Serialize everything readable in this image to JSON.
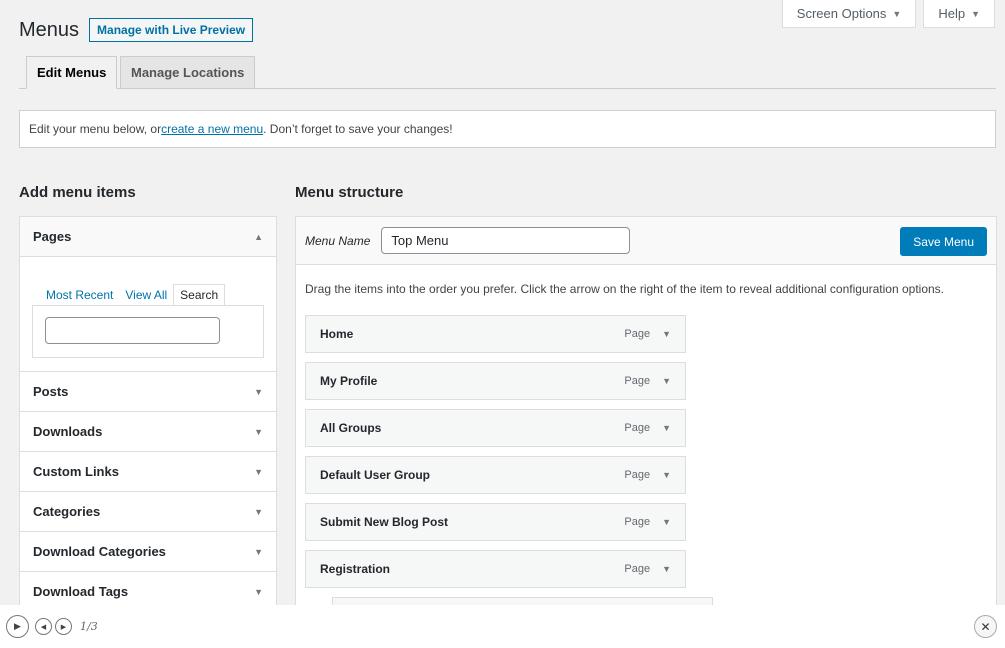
{
  "screen_tabs": [
    {
      "label": "Screen Options",
      "caret": "▼"
    },
    {
      "label": "Help",
      "caret": "▼"
    }
  ],
  "header": {
    "title": "Menus",
    "preview_button": "Manage with Live Preview"
  },
  "tabs": [
    {
      "label": "Edit Menus"
    },
    {
      "label": "Manage Locations"
    }
  ],
  "notice": {
    "before": "Edit your menu below, or ",
    "link": "create a new menu",
    "after": ". Don’t forget to save your changes!"
  },
  "add_items": {
    "heading": "Add menu items",
    "pages": {
      "label": "Pages",
      "caret": "▲",
      "subtabs": [
        "Most Recent",
        "View All",
        "Search"
      ],
      "search_value": ""
    },
    "sections": [
      {
        "label": "Posts",
        "caret": "▼"
      },
      {
        "label": "Downloads",
        "caret": "▼"
      },
      {
        "label": "Custom Links",
        "caret": "▼"
      },
      {
        "label": "Categories",
        "caret": "▼"
      },
      {
        "label": "Download Categories",
        "caret": "▼"
      },
      {
        "label": "Download Tags",
        "caret": "▼"
      }
    ]
  },
  "structure": {
    "heading": "Menu structure",
    "name_label": "Menu Name",
    "name_value": "Top Menu",
    "save_label": "Save Menu",
    "instructions": "Drag the items into the order you prefer. Click the arrow on the right of the item to reveal additional configuration options.",
    "items": [
      {
        "title": "Home",
        "type": "Page",
        "arrow": "▼"
      },
      {
        "title": "My Profile",
        "type": "Page",
        "arrow": "▼"
      },
      {
        "title": "All Groups",
        "type": "Page",
        "arrow": "▼"
      },
      {
        "title": "Default User Group",
        "type": "Page",
        "arrow": "▼"
      },
      {
        "title": "Submit New Blog Post",
        "type": "Page",
        "arrow": "▼"
      },
      {
        "title": "Registration",
        "type": "Page",
        "arrow": "▼"
      }
    ]
  },
  "player": {
    "play": "▶",
    "prev": "◀",
    "next": "▶",
    "counter": "1/3",
    "close": "✕"
  }
}
